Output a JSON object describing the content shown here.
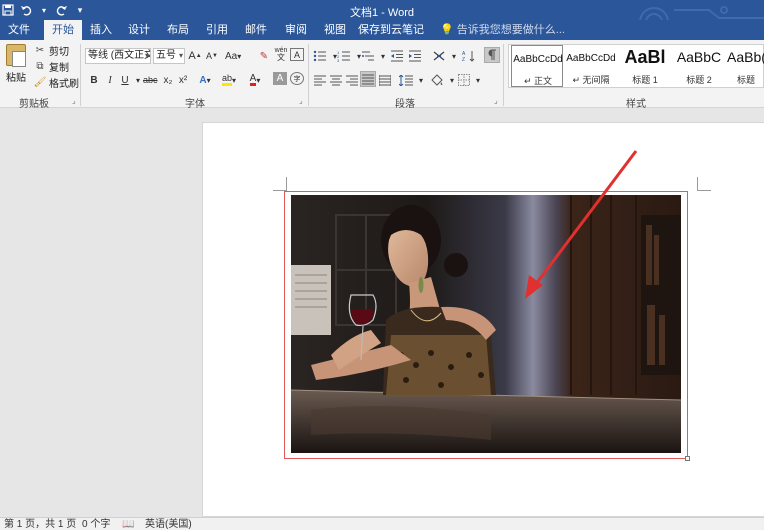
{
  "app": {
    "title": "文档1 - Word",
    "tell_me_placeholder": "告诉我您想要做什么..."
  },
  "quick_access": {
    "save_icon": "save-icon",
    "undo_icon": "undo-icon",
    "redo_icon": "redo-icon",
    "customize_icon": "customize-icon"
  },
  "tabs": [
    "文件",
    "开始",
    "插入",
    "设计",
    "布局",
    "引用",
    "邮件",
    "审阅",
    "视图",
    "保存到云笔记"
  ],
  "active_tab": "开始",
  "clipboard": {
    "paste_label": "粘贴",
    "cut_label": "剪切",
    "copy_label": "复制",
    "format_painter_label": "格式刷",
    "group_label": "剪贴板"
  },
  "font": {
    "font_name": "等线 (西文正文)",
    "font_size": "五号",
    "grow_label": "A",
    "shrink_label": "A",
    "case_label": "Aa",
    "wen_label": "wén",
    "border_char_label": "A",
    "bold": "B",
    "italic": "I",
    "underline": "U",
    "strike": "abc",
    "subscript": "x₂",
    "superscript": "x²",
    "effects": "A",
    "highlight": "ab",
    "font_color": "A",
    "shade_char": "A",
    "enclose": "字",
    "group_label": "字体"
  },
  "paragraph": {
    "group_label": "段落"
  },
  "styles": {
    "items": [
      {
        "sample": "AaBbCcDd",
        "name": "↵ 正文"
      },
      {
        "sample": "AaBbCcDd",
        "name": "↵ 无间隔"
      },
      {
        "sample": "AaBl",
        "name": "标题 1"
      },
      {
        "sample": "AaBbC",
        "name": "标题 2"
      },
      {
        "sample": "AaBb(",
        "name": "标题"
      }
    ],
    "group_label": "样式"
  },
  "status": {
    "page": "第 1 页，共 1 页",
    "words": "0 个字",
    "language": "英语(美国)"
  },
  "colors": {
    "brand": "#2b579a",
    "ribbon_bg": "#f3f3f3",
    "annotation_arrow": "#e03030",
    "selection_border": "#e05a5a"
  }
}
